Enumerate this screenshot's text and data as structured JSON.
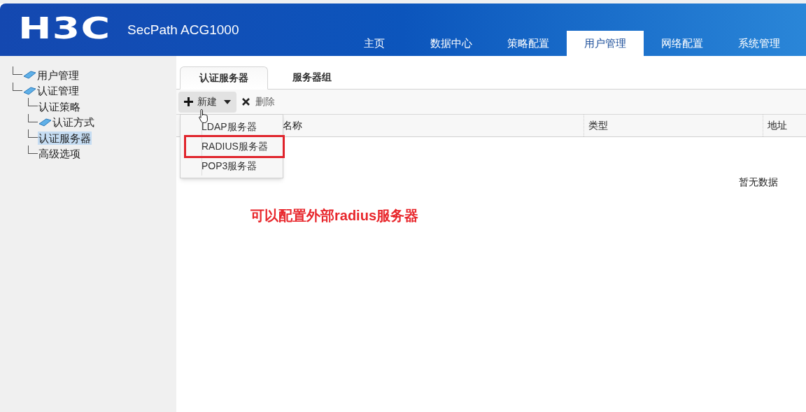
{
  "header": {
    "logo": "H3C",
    "product": "SecPath ACG1000"
  },
  "nav": [
    {
      "label": "主页",
      "selected": false
    },
    {
      "label": "数据中心",
      "selected": false
    },
    {
      "label": "策略配置",
      "selected": false
    },
    {
      "label": "用户管理",
      "selected": true
    },
    {
      "label": "网络配置",
      "selected": false
    },
    {
      "label": "系统管理",
      "selected": false
    }
  ],
  "sidebar": {
    "tree": [
      {
        "label": "用户管理",
        "kind": "folder",
        "selected": false
      },
      {
        "label": "认证管理",
        "kind": "folder",
        "selected": false,
        "children": [
          {
            "label": "认证策略",
            "kind": "leaf",
            "selected": false
          },
          {
            "label": "认证方式",
            "kind": "folder",
            "selected": false
          },
          {
            "label": "认证服务器",
            "kind": "leaf",
            "selected": true
          },
          {
            "label": "高级选项",
            "kind": "leaf",
            "selected": false
          }
        ]
      }
    ]
  },
  "tabs": [
    {
      "label": "认证服务器",
      "selected": true
    },
    {
      "label": "服务器组",
      "selected": false
    }
  ],
  "toolbar": {
    "new_button": "新建",
    "delete_button": "删除"
  },
  "new_menu": [
    {
      "label": "LDAP服务器",
      "highlighted": false
    },
    {
      "label": "RADIUS服务器",
      "highlighted": true
    },
    {
      "label": "POP3服务器",
      "highlighted": false
    }
  ],
  "table": {
    "columns": [
      "名称",
      "类型",
      "地址"
    ],
    "empty_text": "暂无数据"
  },
  "annotation": "可以配置外部radius服务器"
}
